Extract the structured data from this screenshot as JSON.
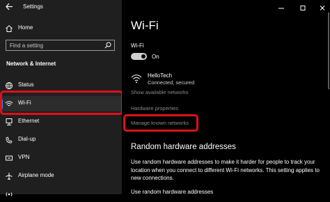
{
  "window": {
    "title": "Settings",
    "minimize_icon": "minimize-icon",
    "maximize_icon": "maximize-icon",
    "close_icon": "close-icon"
  },
  "sidebar": {
    "home_label": "Home",
    "search_placeholder": "Find a setting",
    "section_title": "Network & Internet",
    "items": [
      {
        "label": "Status",
        "icon": "globe-icon"
      },
      {
        "label": "Wi-Fi",
        "icon": "wifi-icon",
        "selected": true
      },
      {
        "label": "Ethernet",
        "icon": "ethernet-icon"
      },
      {
        "label": "Dial-up",
        "icon": "dialup-icon"
      },
      {
        "label": "VPN",
        "icon": "vpn-icon"
      },
      {
        "label": "Airplane mode",
        "icon": "airplane-icon"
      }
    ]
  },
  "main": {
    "title": "Wi-Fi",
    "wifi_label": "Wi-Fi",
    "toggle_state": "On",
    "network": {
      "name": "HelloTech",
      "status": "Connected, secured"
    },
    "show_available": "Show available networks",
    "hardware_properties": "Hardware properties",
    "manage_known": "Manage known networks",
    "random_hw_title": "Random hardware addresses",
    "random_hw_desc": "Use random hardware addresses to make it harder for people to track your location when you connect to different Wi-Fi networks. This setting applies to new connections.",
    "random_hw_sub": "Use random hardware addresses"
  },
  "colors": {
    "accent": "#2f8ee8",
    "highlight_box": "#e0101a",
    "sidebar_bg": "#1f1f1f",
    "main_bg": "#000000",
    "dim_text": "#8a8a8a"
  }
}
